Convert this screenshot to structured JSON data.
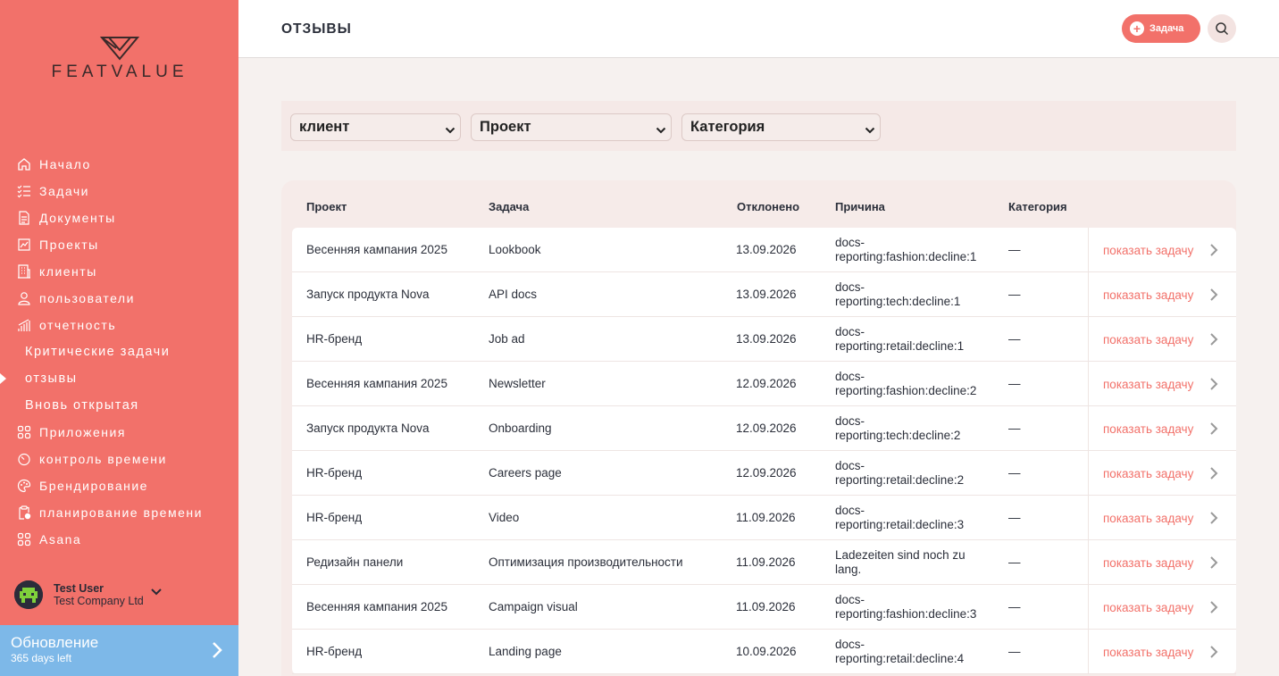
{
  "app": {
    "logo_text": "FEATVALUE",
    "accent_color": "#f2716a",
    "update_color": "#7db8e8"
  },
  "sidebar": {
    "items": [
      {
        "label": "Начало",
        "icon": "home-icon"
      },
      {
        "label": "Задачи",
        "icon": "tasks-icon"
      },
      {
        "label": "Документы",
        "icon": "documents-icon"
      },
      {
        "label": "Проекты",
        "icon": "projects-icon"
      },
      {
        "label": "клиенты",
        "icon": "building-icon"
      },
      {
        "label": "пользователи",
        "icon": "user-icon"
      },
      {
        "label": "отчетность",
        "icon": "reports-icon"
      },
      {
        "label": "Критические задачи",
        "icon": ""
      },
      {
        "label": "отзывы",
        "icon": "",
        "active": true
      },
      {
        "label": "Вновь открытая",
        "icon": ""
      },
      {
        "label": "Приложения",
        "icon": "apps-icon"
      },
      {
        "label": "контроль времени",
        "icon": "timer-icon"
      },
      {
        "label": "Брендирование",
        "icon": "palette-icon"
      },
      {
        "label": "планирование времени",
        "icon": "clipboard-clock-icon"
      },
      {
        "label": "Asana",
        "icon": "apps-icon"
      }
    ],
    "user": {
      "name": "Test User",
      "company": "Test Company Ltd"
    },
    "update": {
      "title": "Обновление",
      "subtitle": "365 days left"
    }
  },
  "header": {
    "title": "ОТЗЫВЫ",
    "task_button": "Задача"
  },
  "filters": {
    "client": "клиент",
    "project": "Проект",
    "category": "Категория"
  },
  "table": {
    "headers": {
      "project": "Проект",
      "task": "Задача",
      "declined": "Отклонено",
      "reason": "Причина",
      "category": "Категория"
    },
    "action_label": "показать задачу",
    "rows": [
      {
        "project": "Весенняя кампания 2025",
        "task": "Lookbook",
        "declined": "13.09.2026",
        "reason": "docs-reporting:fashion:decline:1",
        "category": "—"
      },
      {
        "project": "Запуск продукта Nova",
        "task": "API docs",
        "declined": "13.09.2026",
        "reason": "docs-reporting:tech:decline:1",
        "category": "—"
      },
      {
        "project": "HR-бренд",
        "task": "Job ad",
        "declined": "13.09.2026",
        "reason": "docs-reporting:retail:decline:1",
        "category": "—"
      },
      {
        "project": "Весенняя кампания 2025",
        "task": "Newsletter",
        "declined": "12.09.2026",
        "reason": "docs-reporting:fashion:decline:2",
        "category": "—"
      },
      {
        "project": "Запуск продукта Nova",
        "task": "Onboarding",
        "declined": "12.09.2026",
        "reason": "docs-reporting:tech:decline:2",
        "category": "—"
      },
      {
        "project": "HR-бренд",
        "task": "Careers page",
        "declined": "12.09.2026",
        "reason": "docs-reporting:retail:decline:2",
        "category": "—"
      },
      {
        "project": "HR-бренд",
        "task": "Video",
        "declined": "11.09.2026",
        "reason": "docs-reporting:retail:decline:3",
        "category": "—"
      },
      {
        "project": "Редизайн панели",
        "task": "Оптимизация производительности",
        "declined": "11.09.2026",
        "reason": "Ladezeiten sind noch zu lang.",
        "category": "—"
      },
      {
        "project": "Весенняя кампания 2025",
        "task": "Campaign visual",
        "declined": "11.09.2026",
        "reason": "docs-reporting:fashion:decline:3",
        "category": "—"
      },
      {
        "project": "HR-бренд",
        "task": "Landing page",
        "declined": "10.09.2026",
        "reason": "docs-reporting:retail:decline:4",
        "category": "—"
      }
    ]
  }
}
